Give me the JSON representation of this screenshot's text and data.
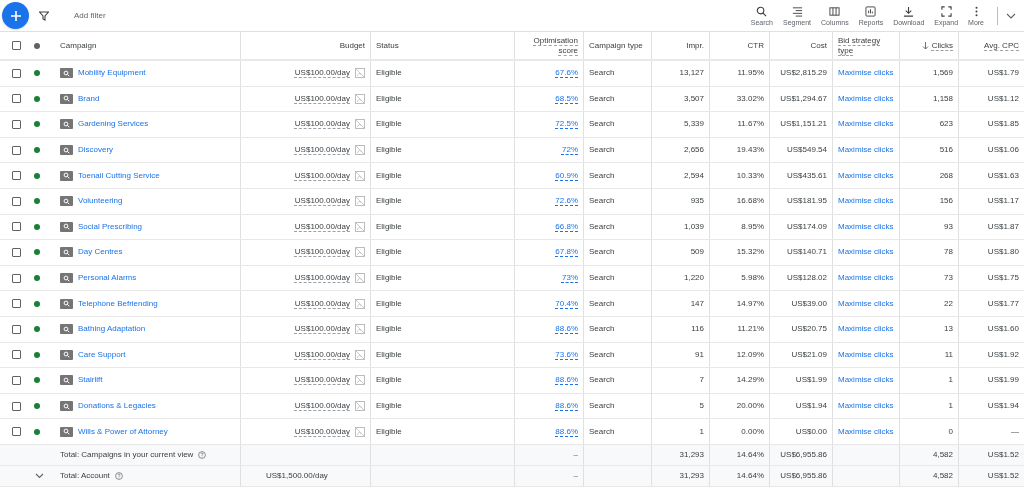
{
  "toolbar": {
    "filter_label": "Add filter",
    "tools": [
      {
        "kind": "search",
        "label": "Search"
      },
      {
        "kind": "segment",
        "label": "Segment"
      },
      {
        "kind": "columns",
        "label": "Columns"
      },
      {
        "kind": "reports",
        "label": "Reports"
      },
      {
        "kind": "download",
        "label": "Download"
      },
      {
        "kind": "expand",
        "label": "Expand"
      },
      {
        "kind": "more",
        "label": "More"
      }
    ]
  },
  "table": {
    "header_checked": false,
    "columns": [
      {
        "label": "Campaign",
        "underlined": false,
        "sorted": false
      },
      {
        "label": "Budget",
        "underlined": false,
        "sorted": false
      },
      {
        "label": "Status",
        "underlined": false,
        "sorted": false
      },
      {
        "label": "Optimisation score",
        "underlined": true,
        "sorted": false
      },
      {
        "label": "Campaign type",
        "underlined": false,
        "sorted": false
      },
      {
        "label": "Impr.",
        "underlined": false,
        "sorted": false
      },
      {
        "label": "CTR",
        "underlined": false,
        "sorted": false
      },
      {
        "label": "Cost",
        "underlined": false,
        "sorted": false
      },
      {
        "label": "Bid strategy type",
        "underlined": true,
        "sorted": false
      },
      {
        "label": "Clicks",
        "underlined": true,
        "sorted": true
      },
      {
        "label": "Avg. CPC",
        "underlined": true,
        "sorted": false
      }
    ],
    "rows": [
      {
        "checked": false,
        "color": "#188038",
        "campaign": "Mobility Equipment",
        "budget": "US$100.00/day",
        "status": "Eligible",
        "optimisation_score": "67.6%",
        "campaign_type": "Search",
        "impr": "13,127",
        "ctr": "11.95%",
        "cost": "US$2,815.29",
        "bid_strategy": "Maximise clicks",
        "clicks": "1,569",
        "avg_cpc": "US$1.79"
      },
      {
        "checked": false,
        "color": "#188038",
        "campaign": "Brand",
        "budget": "US$100.00/day",
        "status": "Eligible",
        "optimisation_score": "68.5%",
        "campaign_type": "Search",
        "impr": "3,507",
        "ctr": "33.02%",
        "cost": "US$1,294.67",
        "bid_strategy": "Maximise clicks",
        "clicks": "1,158",
        "avg_cpc": "US$1.12"
      },
      {
        "checked": false,
        "color": "#188038",
        "campaign": "Gardening Services",
        "budget": "US$100.00/day",
        "status": "Eligible",
        "optimisation_score": "72.5%",
        "campaign_type": "Search",
        "impr": "5,339",
        "ctr": "11.67%",
        "cost": "US$1,151.21",
        "bid_strategy": "Maximise clicks",
        "clicks": "623",
        "avg_cpc": "US$1.85"
      },
      {
        "checked": false,
        "color": "#188038",
        "campaign": "Discovery",
        "budget": "US$100.00/day",
        "status": "Eligible",
        "optimisation_score": "72%",
        "campaign_type": "Search",
        "impr": "2,656",
        "ctr": "19.43%",
        "cost": "US$549.54",
        "bid_strategy": "Maximise clicks",
        "clicks": "516",
        "avg_cpc": "US$1.06"
      },
      {
        "checked": false,
        "color": "#188038",
        "campaign": "Toenail Cutting Service",
        "budget": "US$100.00/day",
        "status": "Eligible",
        "optimisation_score": "60.9%",
        "campaign_type": "Search",
        "impr": "2,594",
        "ctr": "10.33%",
        "cost": "US$435.61",
        "bid_strategy": "Maximise clicks",
        "clicks": "268",
        "avg_cpc": "US$1.63"
      },
      {
        "checked": false,
        "color": "#188038",
        "campaign": "Volunteering",
        "budget": "US$100.00/day",
        "status": "Eligible",
        "optimisation_score": "72.6%",
        "campaign_type": "Search",
        "impr": "935",
        "ctr": "16.68%",
        "cost": "US$181.95",
        "bid_strategy": "Maximise clicks",
        "clicks": "156",
        "avg_cpc": "US$1.17"
      },
      {
        "checked": false,
        "color": "#188038",
        "campaign": "Social Prescribing",
        "budget": "US$100.00/day",
        "status": "Eligible",
        "optimisation_score": "66.8%",
        "campaign_type": "Search",
        "impr": "1,039",
        "ctr": "8.95%",
        "cost": "US$174.09",
        "bid_strategy": "Maximise clicks",
        "clicks": "93",
        "avg_cpc": "US$1.87"
      },
      {
        "checked": false,
        "color": "#188038",
        "campaign": "Day Centres",
        "budget": "US$100.00/day",
        "status": "Eligible",
        "optimisation_score": "67.8%",
        "campaign_type": "Search",
        "impr": "509",
        "ctr": "15.32%",
        "cost": "US$140.71",
        "bid_strategy": "Maximise clicks",
        "clicks": "78",
        "avg_cpc": "US$1.80"
      },
      {
        "checked": false,
        "color": "#188038",
        "campaign": "Personal Alarms",
        "budget": "US$100.00/day",
        "status": "Eligible",
        "optimisation_score": "73%",
        "campaign_type": "Search",
        "impr": "1,220",
        "ctr": "5.98%",
        "cost": "US$128.02",
        "bid_strategy": "Maximise clicks",
        "clicks": "73",
        "avg_cpc": "US$1.75"
      },
      {
        "checked": false,
        "color": "#188038",
        "campaign": "Telephone Befriending",
        "budget": "US$100.00/day",
        "status": "Eligible",
        "optimisation_score": "70.4%",
        "campaign_type": "Search",
        "impr": "147",
        "ctr": "14.97%",
        "cost": "US$39.00",
        "bid_strategy": "Maximise clicks",
        "clicks": "22",
        "avg_cpc": "US$1.77"
      },
      {
        "checked": false,
        "color": "#188038",
        "campaign": "Bathing Adaptation",
        "budget": "US$100.00/day",
        "status": "Eligible",
        "optimisation_score": "88.6%",
        "campaign_type": "Search",
        "impr": "116",
        "ctr": "11.21%",
        "cost": "US$20.75",
        "bid_strategy": "Maximise clicks",
        "clicks": "13",
        "avg_cpc": "US$1.60"
      },
      {
        "checked": false,
        "color": "#188038",
        "campaign": "Care Support",
        "budget": "US$100.00/day",
        "status": "Eligible",
        "optimisation_score": "73.6%",
        "campaign_type": "Search",
        "impr": "91",
        "ctr": "12.09%",
        "cost": "US$21.09",
        "bid_strategy": "Maximise clicks",
        "clicks": "11",
        "avg_cpc": "US$1.92"
      },
      {
        "checked": false,
        "color": "#188038",
        "campaign": "Stairlift",
        "budget": "US$100.00/day",
        "status": "Eligible",
        "optimisation_score": "88.6%",
        "campaign_type": "Search",
        "impr": "7",
        "ctr": "14.29%",
        "cost": "US$1.99",
        "bid_strategy": "Maximise clicks",
        "clicks": "1",
        "avg_cpc": "US$1.99"
      },
      {
        "checked": false,
        "color": "#188038",
        "campaign": "Donations & Legacies",
        "budget": "US$100.00/day",
        "status": "Eligible",
        "optimisation_score": "88.6%",
        "campaign_type": "Search",
        "impr": "5",
        "ctr": "20.00%",
        "cost": "US$1.94",
        "bid_strategy": "Maximise clicks",
        "clicks": "1",
        "avg_cpc": "US$1.94"
      },
      {
        "checked": false,
        "color": "#188038",
        "campaign": "Wills & Power of Attorney",
        "budget": "US$100.00/day",
        "status": "Eligible",
        "optimisation_score": "88.6%",
        "campaign_type": "Search",
        "impr": "1",
        "ctr": "0.00%",
        "cost": "US$0.00",
        "bid_strategy": "Maximise clicks",
        "clicks": "0",
        "avg_cpc": "—"
      }
    ],
    "totals": [
      {
        "toggle": false,
        "label": "Total: Campaigns in your current view",
        "optimisation_score": "–",
        "impr": "31,293",
        "ctr": "14.64%",
        "cost": "US$6,955.86",
        "clicks": "4,582",
        "avg_cpc": "US$1.52"
      },
      {
        "toggle": true,
        "label": "Total: Account",
        "budget": "US$1,500.00/day",
        "optimisation_score": "–",
        "impr": "31,293",
        "ctr": "14.64%",
        "cost": "US$6,955.86",
        "clicks": "4,582",
        "avg_cpc": "US$1.52"
      }
    ]
  }
}
